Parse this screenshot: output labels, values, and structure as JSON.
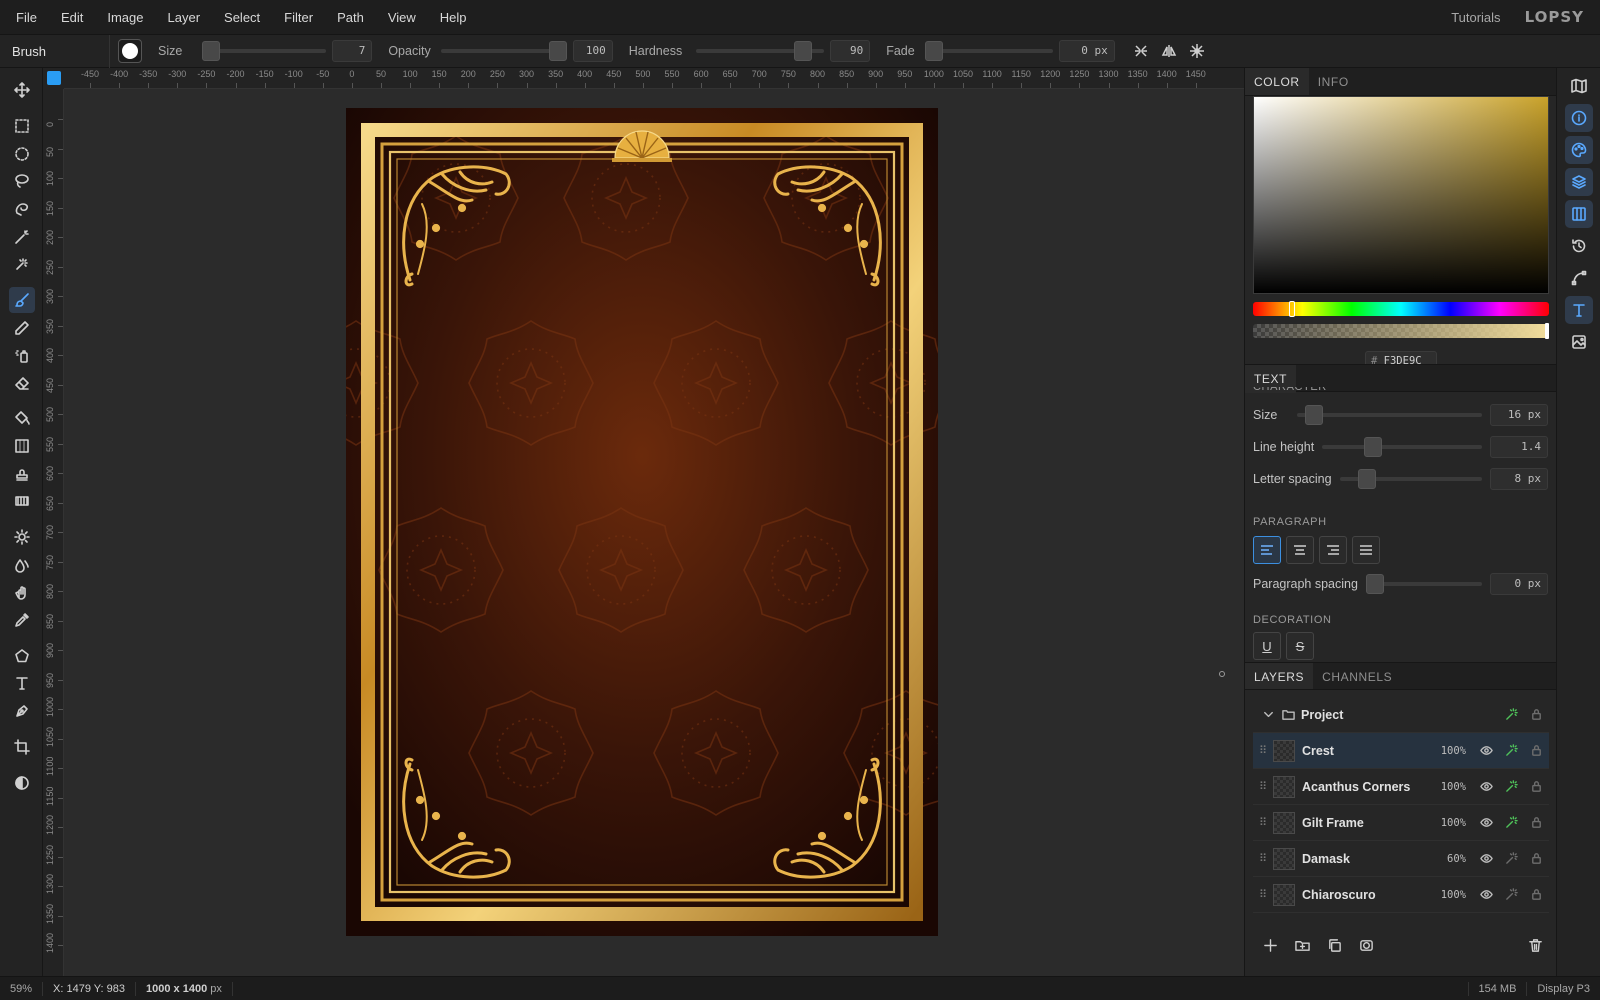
{
  "menu": {
    "items": [
      "File",
      "Edit",
      "Image",
      "Layer",
      "Select",
      "Filter",
      "Path",
      "View",
      "Help"
    ],
    "tutorials": "Tutorials",
    "logo": "LOPSY"
  },
  "options": {
    "tool_name": "Brush",
    "size_label": "Size",
    "size_value": "7",
    "opacity_label": "Opacity",
    "opacity_value": "100",
    "hardness_label": "Hardness",
    "hardness_value": "90",
    "fade_label": "Fade",
    "fade_value": "0",
    "fade_unit": "px"
  },
  "rulers": {
    "top": [
      "-450",
      "-400",
      "-350",
      "-300",
      "-250",
      "-200",
      "-150",
      "-100",
      "-50",
      "0",
      "50",
      "100",
      "150",
      "200",
      "250",
      "300",
      "350",
      "400",
      "450",
      "500",
      "550",
      "600",
      "650",
      "700",
      "750",
      "800",
      "850",
      "900",
      "950",
      "1000",
      "1050",
      "1100",
      "1150",
      "1200",
      "1250",
      "1300",
      "1350",
      "1400",
      "1450"
    ],
    "left": [
      "0",
      "50",
      "100",
      "150",
      "200",
      "250",
      "300",
      "350",
      "400",
      "450",
      "500",
      "550",
      "600",
      "650",
      "700",
      "750",
      "800",
      "850",
      "900",
      "950",
      "1000",
      "1050",
      "1100",
      "1150",
      "1200",
      "1250",
      "1300",
      "1350",
      "1400"
    ]
  },
  "color_panel": {
    "tabs": [
      "COLOR",
      "INFO"
    ],
    "active_tab": "COLOR",
    "hex_prefix": "#",
    "hex": "F3DE9C",
    "hue_color": "#c9a22a"
  },
  "text_panel": {
    "title": "TEXT",
    "character_partial": "CHARACTER",
    "size_label": "Size",
    "size_value": "16",
    "size_unit": "px",
    "line_height_label": "Line height",
    "line_height_value": "1.4",
    "letter_spacing_label": "Letter spacing",
    "letter_spacing_value": "8",
    "letter_spacing_unit": "px",
    "paragraph_label": "PARAGRAPH",
    "paragraph_spacing_label": "Paragraph spacing",
    "paragraph_spacing_value": "0",
    "paragraph_spacing_unit": "px",
    "decoration_label": "DECORATION",
    "underline": "U",
    "strike": "S"
  },
  "layers_panel": {
    "tabs": [
      "LAYERS",
      "CHANNELS"
    ],
    "group": "Project",
    "layers": [
      {
        "name": "Crest",
        "opacity": "100%"
      },
      {
        "name": "Acanthus Corners",
        "opacity": "100%"
      },
      {
        "name": "Gilt Frame",
        "opacity": "100%"
      },
      {
        "name": "Damask",
        "opacity": "60%"
      },
      {
        "name": "Chiaroscuro",
        "opacity": "100%"
      }
    ]
  },
  "status": {
    "zoom": "59%",
    "coords": "X: 1479 Y: 983",
    "doc_size": "1000 x 1400",
    "doc_unit": "px",
    "memory": "154 MB",
    "profile": "Display P3"
  },
  "colors": {
    "accent": "#2a9df4",
    "gold": "#d9a845",
    "canvas_bg": "#3a1a0a"
  }
}
